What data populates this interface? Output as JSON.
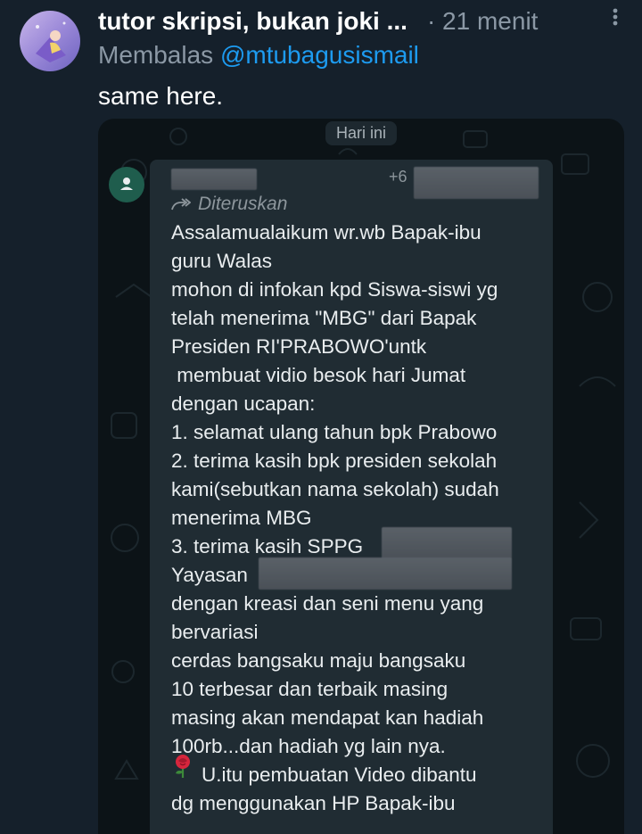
{
  "tweet": {
    "author_name": "tutor skripsi, bukan joki ...",
    "time": "· 21 menit",
    "reply_prefix": "Membalas",
    "reply_handle": "@mtubagusismail",
    "text": "same here."
  },
  "whatsapp": {
    "date_chip": "Hari ini",
    "sender_number_prefix": "+6",
    "forwarded_label": "Diteruskan",
    "message_lines": [
      "Assalamualaikum wr.wb Bapak-ibu",
      "guru Walas",
      "mohon di infokan kpd Siswa-siswi yg",
      "telah menerima \"MBG\" dari Bapak",
      "Presiden RI'PRABOWO'untk",
      " membuat vidio besok hari Jumat",
      "dengan ucapan:",
      "1. selamat ulang tahun bpk Prabowo",
      "2. terima kasih bpk presiden sekolah",
      "kami(sebutkan nama sekolah) sudah",
      "menerima MBG",
      "3. terima kasih SPPG",
      "Yayasan",
      "dengan kreasi dan seni menu yang",
      "bervariasi",
      "cerdas bangsaku maju bangsaku",
      "10 terbesar dan terbaik masing",
      "masing akan mendapat kan hadiah",
      "100rb...dan hadiah yg lain nya.",
      "U.itu pembuatan Video dibantu",
      "dg menggunakan HP Bapak-ibu"
    ]
  },
  "icons": {
    "more": "more-vertical-icon",
    "forward": "forward-icon",
    "rose": "rose-emoji-icon",
    "contact": "person-icon"
  },
  "colors": {
    "background": "#15202b",
    "link": "#1d9bf0",
    "muted": "#8b98a5",
    "bubble": "#202c33"
  }
}
